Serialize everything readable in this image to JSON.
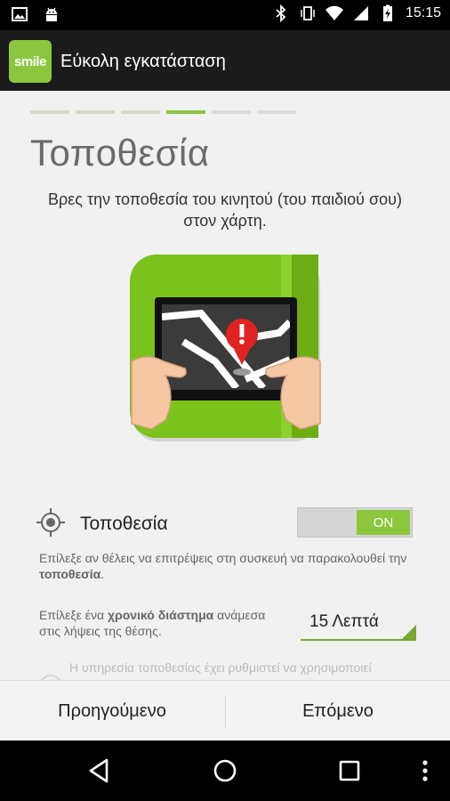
{
  "status_bar": {
    "time": "15:15",
    "left_icons": [
      "image-icon",
      "android-icon"
    ],
    "right_icons": [
      "bluetooth-icon",
      "vibrate-icon",
      "wifi-icon",
      "signal-icon",
      "battery-charging-icon"
    ]
  },
  "action_bar": {
    "logo_text": "smile",
    "title": "Εύκολη εγκατάσταση"
  },
  "wizard": {
    "total_steps": 6,
    "current_step": 4,
    "title": "Τοποθεσία",
    "description": "Βρες την τοποθεσία του κινητού (του παιδιού σου) στον χάρτη."
  },
  "location_setting": {
    "icon": "crosshair-icon",
    "label": "Τοποθεσία",
    "toggle_state": "ON",
    "help_before": "Επίλεξε αν θέλεις να επιτρέψεις στη συσκευή να παρακολουθεί την ",
    "help_bold": "τοποθεσία",
    "help_after": "."
  },
  "interval_setting": {
    "help_before": "Επίλεξε ένα ",
    "help_bold": "χρονικό διάστημα",
    "help_after": " ανάμεσα στις λήψεις της θέσης.",
    "selected_value": "15 Λεπτά"
  },
  "faded_text": "Η υπηρεσία τοποθεσίας έχει ρυθμιστεί να χρησιμοποιεί",
  "buttons": {
    "previous": "Προηγούμενο",
    "next": "Επόμενο"
  },
  "colors": {
    "accent": "#8cc63f",
    "action_bar": "#1b1b1b"
  }
}
